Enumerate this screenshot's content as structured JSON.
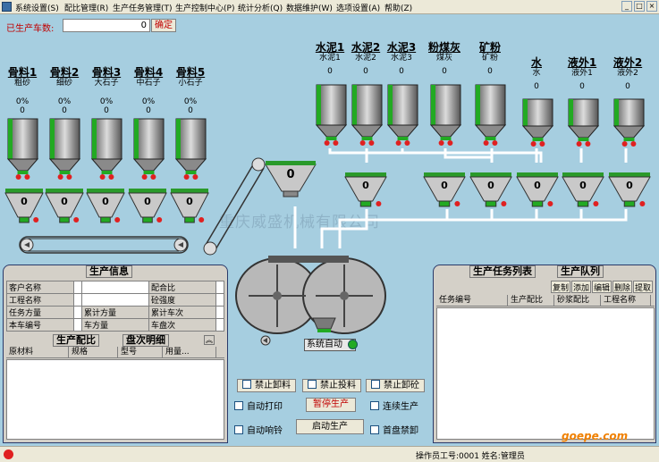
{
  "menu": [
    "系统设置(S)",
    "配比管理(R)",
    "生产任务管理(T)",
    "生产控制中心(P)",
    "统计分析(Q)",
    "数据维护(W)",
    "选项设置(A)",
    "帮助(Z)"
  ],
  "window_buttons": [
    "_",
    "□",
    "×"
  ],
  "counter": {
    "label": "已生产车数:",
    "value": "0",
    "confirm": "确定"
  },
  "aggregates": [
    {
      "title": "骨料1",
      "sub": "粗砂",
      "pct": "0%",
      "val": "0"
    },
    {
      "title": "骨料2",
      "sub": "细砂",
      "pct": "0%",
      "val": "0"
    },
    {
      "title": "骨料3",
      "sub": "大石子",
      "pct": "0%",
      "val": "0"
    },
    {
      "title": "骨料4",
      "sub": "中石子",
      "pct": "0%",
      "val": "0"
    },
    {
      "title": "骨料5",
      "sub": "小石子",
      "pct": "0%",
      "val": "0"
    }
  ],
  "agg_hoppers": [
    "0",
    "0",
    "0",
    "0",
    "0"
  ],
  "top_materials": [
    {
      "title": "水泥1",
      "sub": "水泥1",
      "val": "0"
    },
    {
      "title": "水泥2",
      "sub": "水泥2",
      "val": "0"
    },
    {
      "title": "水泥3",
      "sub": "水泥3",
      "val": "0"
    },
    {
      "title": "粉煤灰",
      "sub": "煤灰",
      "val": "0"
    },
    {
      "title": "矿粉",
      "sub": "矿粉",
      "val": "0"
    },
    {
      "title": "水",
      "sub": "水",
      "val": "0"
    },
    {
      "title": "液外1",
      "sub": "液外1",
      "val": "0"
    },
    {
      "title": "液外2",
      "sub": "液外2",
      "val": "0"
    }
  ],
  "powder_hoppers": [
    "0",
    "0",
    "0",
    "0",
    "0",
    "0",
    "0"
  ],
  "mixer_hopper": "0",
  "watermark": "重庆威盛机械有限公司",
  "system_status": "系统自动",
  "production_info": {
    "title": "生产信息",
    "rows": [
      [
        "客户名称",
        "",
        "配合比",
        ""
      ],
      [
        "工程名称",
        "",
        "砼强度",
        ""
      ],
      [
        "任务方量",
        "累计方量",
        "累计车次",
        ""
      ],
      [
        "本车编号",
        "车方量",
        "车盘次",
        ""
      ]
    ]
  },
  "tabs_left": [
    "生产配比",
    "盘次明细"
  ],
  "recipe_columns": [
    "原材料",
    "规格",
    "型号",
    "用量..."
  ],
  "task_panel": {
    "tabs": [
      "生产任务列表",
      "生产队列"
    ],
    "buttons": [
      "复制",
      "添加",
      "编辑",
      "删除",
      "提取"
    ],
    "columns": [
      "任务编号",
      "生产配比",
      "砂浆配比",
      "工程名称"
    ]
  },
  "controls": {
    "forbid_unload": "禁止卸料",
    "forbid_feed": "禁止投料",
    "forbid_concrete": "禁止卸砼",
    "auto_print": "自动打印",
    "pause": "暂停生产",
    "continuous": "连续生产",
    "auto_bell": "自动响铃",
    "start": "启动生产",
    "first_disc": "首盘禁卸"
  },
  "status": {
    "operator": "操作员工号:0001 姓名:管理员"
  },
  "brand": "goepe.com",
  "colors": {
    "silo_dark": "#5a5a5a",
    "silo_light": "#d8d8d8",
    "indicator_green": "#22aa22",
    "indicator_red": "#e02020",
    "pipe": "#ffffff"
  }
}
